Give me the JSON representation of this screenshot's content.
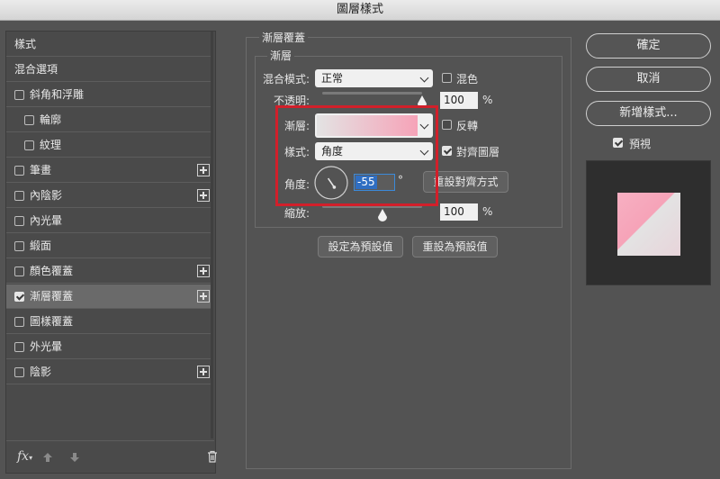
{
  "window": {
    "title": "圖層樣式"
  },
  "sidebar": {
    "items": [
      {
        "label": "樣式",
        "checkbox": false,
        "checked": false,
        "indent": false,
        "plus": false,
        "selected": false
      },
      {
        "label": "混合選項",
        "checkbox": false,
        "checked": false,
        "indent": false,
        "plus": false,
        "selected": false
      },
      {
        "label": "斜角和浮雕",
        "checkbox": true,
        "checked": false,
        "indent": false,
        "plus": false,
        "selected": false
      },
      {
        "label": "輪廓",
        "checkbox": true,
        "checked": false,
        "indent": true,
        "plus": false,
        "selected": false
      },
      {
        "label": "紋理",
        "checkbox": true,
        "checked": false,
        "indent": true,
        "plus": false,
        "selected": false
      },
      {
        "label": "筆畫",
        "checkbox": true,
        "checked": false,
        "indent": false,
        "plus": true,
        "selected": false
      },
      {
        "label": "內陰影",
        "checkbox": true,
        "checked": false,
        "indent": false,
        "plus": true,
        "selected": false
      },
      {
        "label": "內光暈",
        "checkbox": true,
        "checked": false,
        "indent": false,
        "plus": false,
        "selected": false
      },
      {
        "label": "緞面",
        "checkbox": true,
        "checked": false,
        "indent": false,
        "plus": false,
        "selected": false
      },
      {
        "label": "顏色覆蓋",
        "checkbox": true,
        "checked": false,
        "indent": false,
        "plus": true,
        "selected": false
      },
      {
        "label": "漸層覆蓋",
        "checkbox": true,
        "checked": true,
        "indent": false,
        "plus": true,
        "selected": true
      },
      {
        "label": "圖樣覆蓋",
        "checkbox": true,
        "checked": false,
        "indent": false,
        "plus": false,
        "selected": false
      },
      {
        "label": "外光暈",
        "checkbox": true,
        "checked": false,
        "indent": false,
        "plus": false,
        "selected": false
      },
      {
        "label": "陰影",
        "checkbox": true,
        "checked": false,
        "indent": false,
        "plus": true,
        "selected": false
      }
    ],
    "footer": {
      "fx_label": "fx"
    }
  },
  "panel": {
    "title": "漸層覆蓋",
    "group_title": "漸層",
    "blend_mode_label": "混合模式:",
    "blend_mode_value": "正常",
    "dither_label": "混色",
    "opacity_label": "不透明:",
    "opacity_value": "100",
    "opacity_unit": "%",
    "opacity_level": 1.0,
    "gradient_label": "漸層:",
    "reverse_label": "反轉",
    "style_label": "樣式:",
    "style_value": "角度",
    "align_label": "對齊圖層",
    "angle_label": "角度:",
    "angle_value": "-55",
    "angle_unit": "°",
    "reset_align_button": "重設對齊方式",
    "scale_label": "縮放:",
    "scale_value": "100",
    "scale_unit": "%",
    "scale_level": 0.5,
    "make_default_button": "設定為預設值",
    "reset_default_button": "重設為預設值"
  },
  "actions": {
    "ok": "確定",
    "cancel": "取消",
    "new_style": "新增樣式...",
    "preview_label": "預視"
  },
  "colors": {
    "gradient_start": "#e3e3e3",
    "gradient_end": "#f6a3b8",
    "highlight": "#d21f2a"
  }
}
